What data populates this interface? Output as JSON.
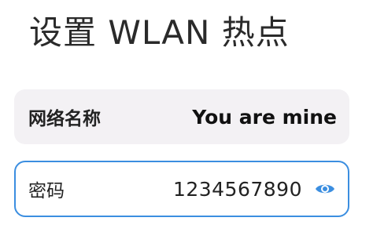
{
  "page": {
    "title": "设置 WLAN 热点"
  },
  "network_name": {
    "label": "网络名称",
    "value": "You are mine"
  },
  "password": {
    "label": "密码",
    "value": "1234567890",
    "visibility_icon": "eye-icon"
  },
  "colors": {
    "accent": "#3b8ee0",
    "card_bg": "#f3f1f4"
  }
}
